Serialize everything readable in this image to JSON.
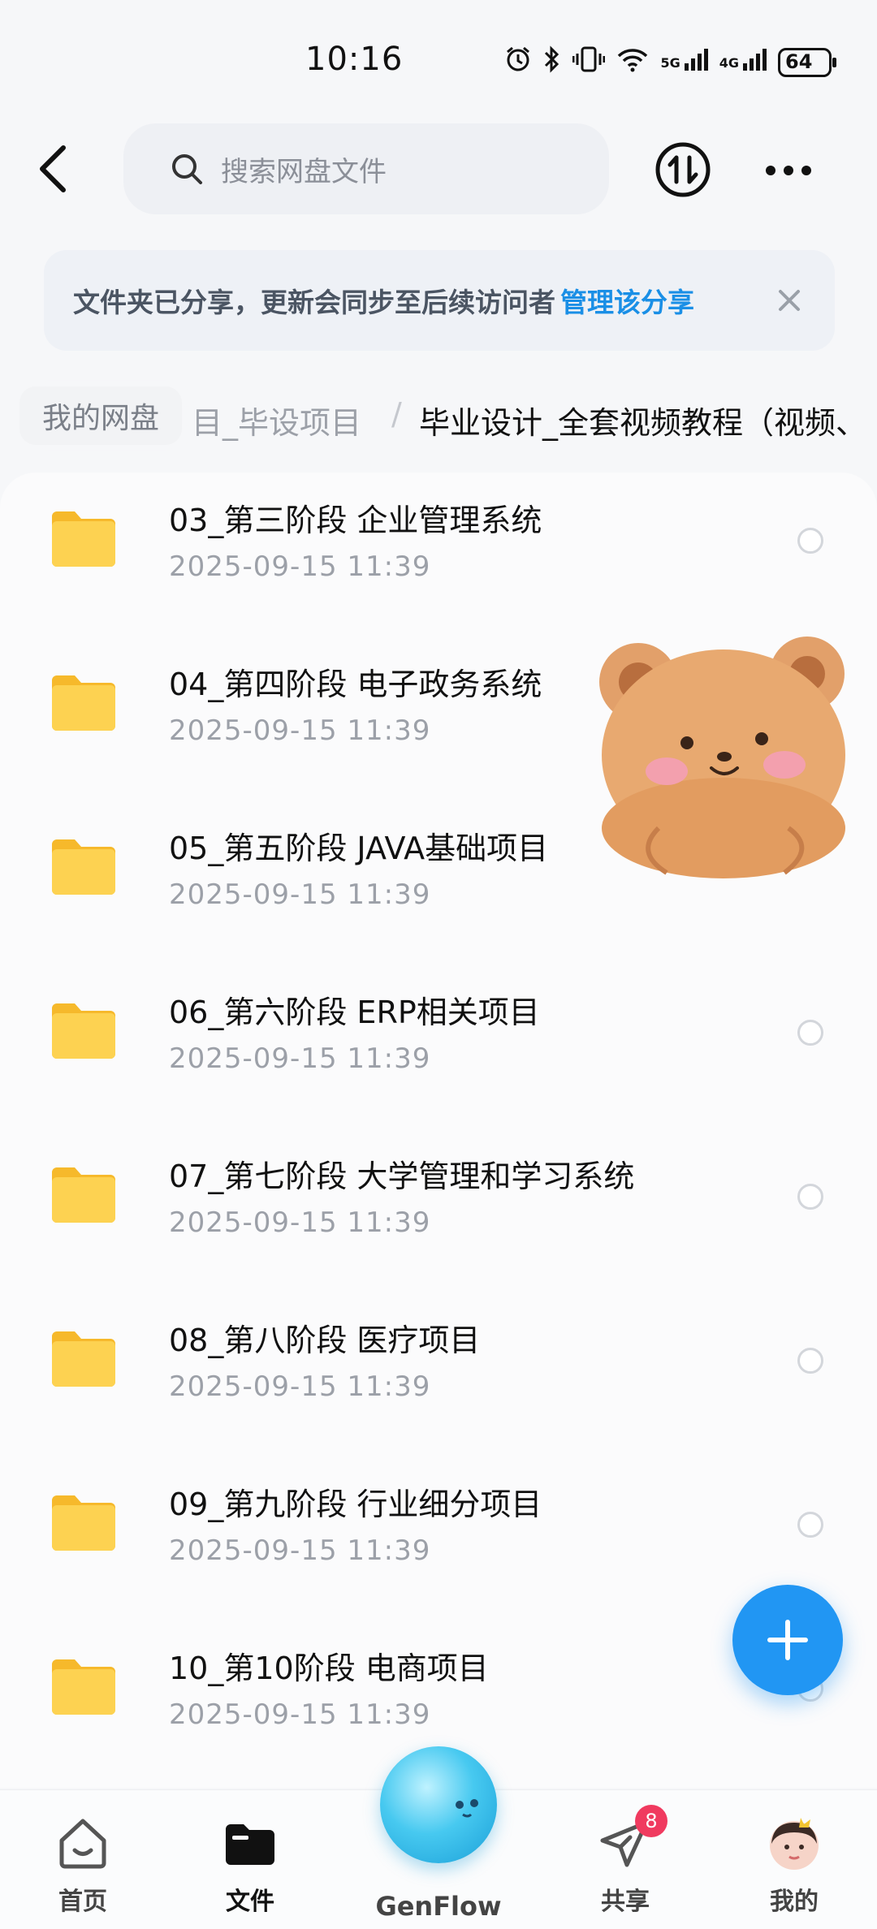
{
  "status_bar": {
    "time": "10:16",
    "signal_5g": "5G",
    "signal_4g": "4G",
    "battery": "64"
  },
  "header": {
    "search_placeholder": "搜索网盘文件"
  },
  "share_banner": {
    "text": "文件夹已分享，更新会同步至后续访问者",
    "link": "管理该分享"
  },
  "breadcrumb": {
    "root": "我的网盘",
    "middle": "目_毕设项目",
    "separator": "/",
    "current": "毕业设计_全套视频教程（视频、"
  },
  "files": [
    {
      "name": "03_第三阶段 企业管理系统",
      "date": "2025-09-15  11:39"
    },
    {
      "name": "04_第四阶段 电子政务系统",
      "date": "2025-09-15  11:39"
    },
    {
      "name": "05_第五阶段 JAVA基础项目",
      "date": "2025-09-15  11:39"
    },
    {
      "name": "06_第六阶段 ERP相关项目",
      "date": "2025-09-15  11:39"
    },
    {
      "name": "07_第七阶段 大学管理和学习系统",
      "date": "2025-09-15  11:39"
    },
    {
      "name": "08_第八阶段 医疗项目",
      "date": "2025-09-15  11:39"
    },
    {
      "name": "09_第九阶段 行业细分项目",
      "date": "2025-09-15  11:39"
    },
    {
      "name": "10_第10阶段 电商项目",
      "date": "2025-09-15  11:39"
    }
  ],
  "bottom_nav": {
    "home": "首页",
    "files": "文件",
    "genflow": "GenFlow",
    "share": "共享",
    "share_badge": "8",
    "mine": "我的"
  },
  "colors": {
    "accent": "#1a8fe6",
    "folder": "#fbc93c",
    "fab": "#2196f3",
    "badge": "#f03a5f"
  }
}
